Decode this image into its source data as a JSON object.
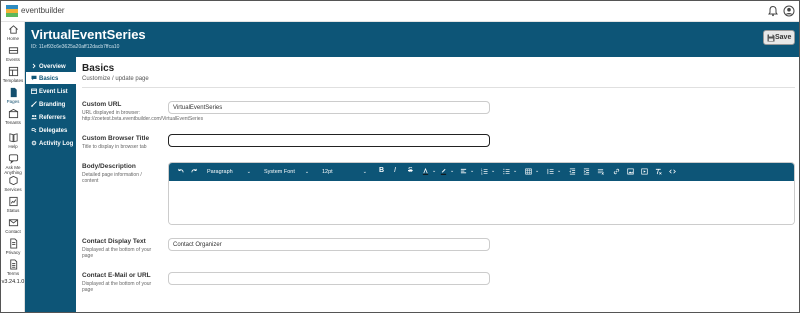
{
  "app": {
    "brand": "eventbuilder",
    "version": "v3.24.1.0"
  },
  "rail": {
    "items": [
      {
        "label": "Home",
        "icon": "home-icon"
      },
      {
        "label": "Events",
        "icon": "events-icon"
      },
      {
        "label": "Templates",
        "icon": "templates-icon"
      },
      {
        "label": "Pages",
        "icon": "pages-icon",
        "active": true
      },
      {
        "label": "Tenants",
        "icon": "tenants-icon"
      },
      {
        "label": "Help",
        "icon": "help-icon"
      },
      {
        "label": "Ask Me Anything",
        "icon": "ask-icon"
      },
      {
        "label": "Services",
        "icon": "services-icon"
      },
      {
        "label": "Status",
        "icon": "status-icon"
      },
      {
        "label": "Contact",
        "icon": "contact-icon"
      },
      {
        "label": "Privacy",
        "icon": "privacy-icon"
      },
      {
        "label": "Terms",
        "icon": "terms-icon"
      }
    ]
  },
  "header": {
    "title": "VirtualEventSeries",
    "id_text": "ID: 11ef93c6e3625a20aff12dacb7ffca10",
    "save_label": "Save"
  },
  "nav": {
    "items": [
      {
        "label": "Overview",
        "icon": "chevron-right-icon"
      },
      {
        "label": "Basics",
        "icon": "comment-icon",
        "active": true
      },
      {
        "label": "Event List",
        "icon": "calendar-icon"
      },
      {
        "label": "Branding",
        "icon": "brush-icon"
      },
      {
        "label": "Referrers",
        "icon": "users-icon"
      },
      {
        "label": "Delegates",
        "icon": "delegates-icon"
      },
      {
        "label": "Activity Log",
        "icon": "gear-icon"
      }
    ]
  },
  "page": {
    "title": "Basics",
    "subtitle": "Customize / update page"
  },
  "fields": {
    "custom_url": {
      "label": "Custom URL",
      "help1": "URL displayed in browser:",
      "help2": "http://zoetest.bvta.eventbuilder.com/VirtualEventSeries",
      "value": "VirtualEventSeries"
    },
    "browser_title": {
      "label": "Custom Browser Title",
      "help": "Title to display in browser tab",
      "value": ""
    },
    "body": {
      "label": "Body/Description",
      "help": "Detailed page information / content"
    },
    "contact_text": {
      "label": "Contact Display Text",
      "help": "Displayed at the bottom of your page",
      "value": "Contact Organizer"
    },
    "contact_email": {
      "label": "Contact E-Mail or URL",
      "help": "Displayed at the bottom of your page",
      "value": ""
    }
  },
  "editor": {
    "block_format": "Paragraph",
    "font_family": "System Font",
    "font_size": "12pt"
  },
  "colors": {
    "primary": "#0d5577",
    "white": "#ffffff"
  }
}
